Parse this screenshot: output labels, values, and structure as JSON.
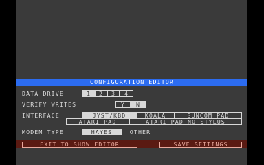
{
  "title": "CONFIGURATION EDITOR",
  "data_drive": {
    "label": "DATA DRIVE",
    "options": [
      "1",
      "2",
      "3",
      "4"
    ],
    "selected": "1"
  },
  "verify_writes": {
    "label": "VERIFY WRITES",
    "options": [
      "Y",
      "N"
    ],
    "selected": "N"
  },
  "interface": {
    "label": "INTERFACE",
    "options_row1": [
      "JYST/KBD",
      "KOALA",
      "SUNCOM PAD"
    ],
    "options_row2": [
      "ATARI PAD",
      "ATARI PAD NO STYLUS"
    ],
    "selected": "JYST/KBD"
  },
  "modem_type": {
    "label": "MODEM TYPE",
    "options": [
      "HAYES",
      "OTHER"
    ],
    "selected": "HAYES"
  },
  "footer": {
    "exit_label": "EXIT TO SHOW EDITOR",
    "save_label": "SAVE SETTINGS"
  },
  "colors": {
    "background": "#3a3a3a",
    "title_bar": "#2c6cf0",
    "footer_bar": "#5a1a12",
    "text": "#d8d8d8"
  }
}
